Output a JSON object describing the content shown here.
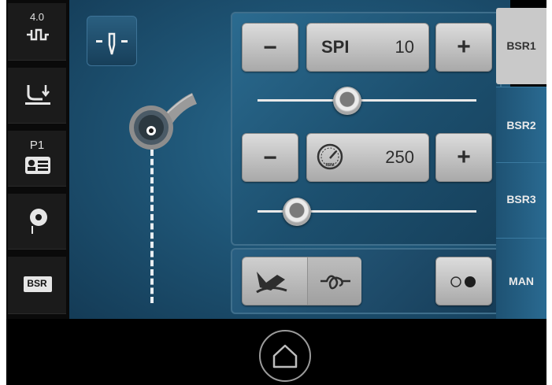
{
  "sidebar": {
    "speed_value": "4.0",
    "items": [
      {
        "name": "stitch-speed",
        "icon": "stitch-pattern-icon"
      },
      {
        "name": "presser-foot",
        "icon": "presser-foot-up-icon"
      },
      {
        "name": "program",
        "label": "P1",
        "icon": "program-card-icon"
      },
      {
        "name": "bobbin-thread",
        "icon": "bobbin-icon"
      },
      {
        "name": "bsr",
        "label": "BSR"
      }
    ]
  },
  "stitch": {
    "spi_label": "SPI",
    "spi_value": "10",
    "spi_slider_fraction": 0.41
  },
  "speed": {
    "value": "250",
    "gauge_label": "RPM",
    "slider_fraction": 0.18
  },
  "buttons": {
    "minus": "−",
    "plus": "+"
  },
  "tabs": [
    {
      "label": "BSR1",
      "active": true
    },
    {
      "label": "BSR2",
      "active": false
    },
    {
      "label": "BSR3",
      "active": false
    },
    {
      "label": "MAN",
      "active": false
    }
  ],
  "colors": {
    "canvas": "#1f5677",
    "panel": "#2b6b90",
    "button": "#c9c9c9",
    "active_tab": "#c9c9c9"
  }
}
